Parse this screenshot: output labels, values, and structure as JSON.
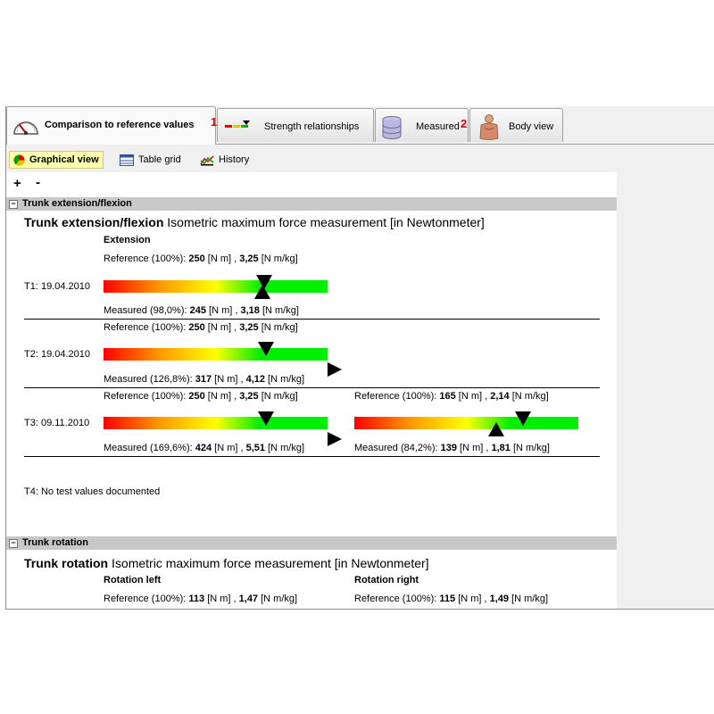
{
  "tabs": [
    {
      "label": "Comparison to reference values",
      "num": "1",
      "icon": "gauge-icon"
    },
    {
      "label": "Strength relationships",
      "icon": "bars-icon"
    },
    {
      "label": "Measured",
      "num": "2",
      "icon": "database-icon"
    },
    {
      "label": "Body view",
      "icon": "body-icon"
    }
  ],
  "toolbar": {
    "graphical": "Graphical view",
    "table": "Table grid",
    "history": "History",
    "plus": "+",
    "minus": "-"
  },
  "section1": {
    "header": "Trunk extension/flexion",
    "title_bold": "Trunk extension/flexion",
    "title_rest": " Isometric maximum force measurement [in Newtonmeter]",
    "col1_label": "Extension",
    "ref": {
      "pre": "Reference (100%): ",
      "nm": "250",
      "mid": " [N m] , ",
      "kg": "3,25",
      "post": " [N m/kg]"
    },
    "rows": [
      {
        "date": "T1: 19.04.2010",
        "meas_pre": "Measured (98,0%): ",
        "nm": "245",
        "kg": "3,18",
        "percent": 98.0
      },
      {
        "date": "T2: 19.04.2010",
        "meas_pre": "Measured (126,8%): ",
        "nm": "317",
        "kg": "4,12",
        "percent": 126.8
      },
      {
        "date": "T3: 09.11.2010",
        "meas_pre": "Measured (169,6%): ",
        "nm": "424",
        "kg": "5,51",
        "percent": 169.6
      }
    ],
    "t3_right": {
      "ref_pre": "Reference (100%): ",
      "ref_nm": "165",
      "ref_kg": "2,14",
      "meas_pre": "Measured (84,2%): ",
      "nm": "139",
      "kg": "1,81",
      "percent": 84.2
    },
    "t4": "T4: No test values documented",
    "unit_nm": " [N m] , ",
    "unit_kg": " [N m/kg]"
  },
  "section2": {
    "header": "Trunk rotation",
    "title_bold": "Trunk rotation",
    "title_rest": " Isometric maximum force measurement [in Newtonmeter]",
    "left_label": "Rotation left",
    "right_label": "Rotation right",
    "left_ref_pre": "Reference (100%): ",
    "left_nm": "113",
    "left_kg": "1,47",
    "right_ref_pre": "Reference (100%): ",
    "right_nm": "115",
    "right_kg": "1,49"
  }
}
